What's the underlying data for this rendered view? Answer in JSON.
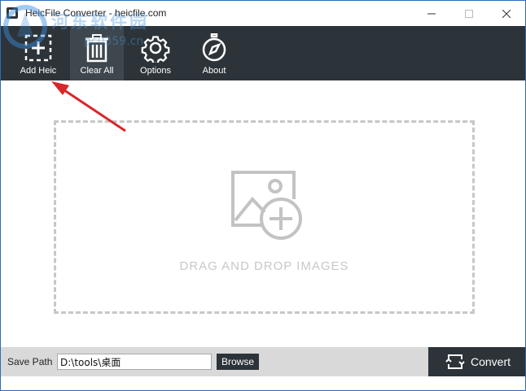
{
  "window": {
    "title": "HeicFile Converter - heicfile.com",
    "controls": [
      "minimize-icon",
      "maximize-icon",
      "close-icon"
    ]
  },
  "watermark": {
    "line1": "河东软件园",
    "line2": "pc0359.cn"
  },
  "toolbar": {
    "items": [
      {
        "label": "Add Heic",
        "icon": "add-file-icon"
      },
      {
        "label": "Clear All",
        "icon": "trash-icon"
      },
      {
        "label": "Options",
        "icon": "gear-icon"
      },
      {
        "label": "About",
        "icon": "compass-icon"
      }
    ],
    "active_index": 1
  },
  "dropzone": {
    "text": "DRAG AND DROP IMAGES",
    "icon": "add-image-icon"
  },
  "bottom": {
    "save_path_label": "Save Path",
    "save_path_value": "D:\\tools\\桌面",
    "browse_label": "Browse",
    "convert_label": "Convert",
    "convert_icon": "convert-icon"
  },
  "colors": {
    "toolbar_bg": "#2d3439",
    "active_tool_bg": "#3e474d",
    "bottom_bar_bg": "#d9d9d9",
    "dropzone_border": "#c7c7c7",
    "annotation_arrow": "#d9262a"
  }
}
